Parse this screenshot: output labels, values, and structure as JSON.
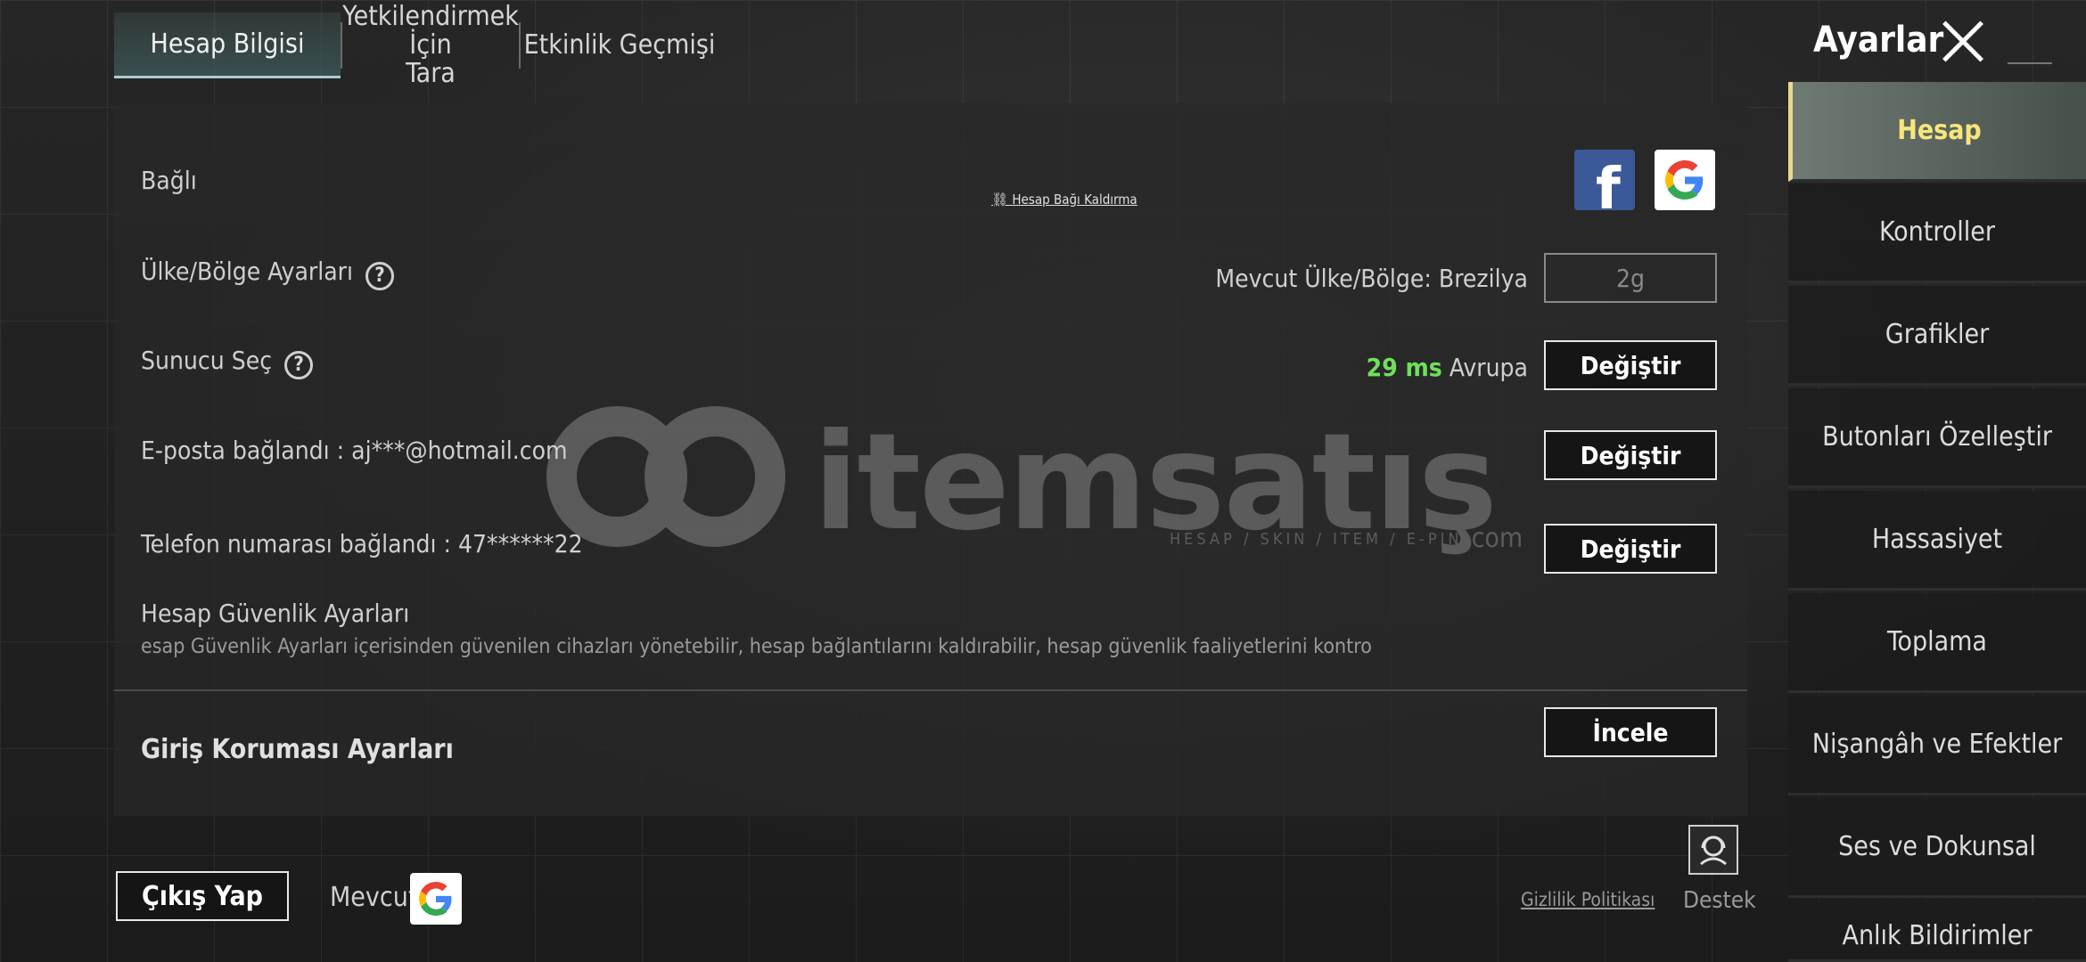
{
  "tabs": [
    {
      "label": "Hesap Bilgisi"
    },
    {
      "label_line1": "Yetkilendirmek İçin",
      "label_line2": "Tara"
    },
    {
      "label": "Etkinlik Geçmişi"
    }
  ],
  "header": {
    "title": "Ayarlar",
    "close_icon": "close-icon"
  },
  "account": {
    "linked_label": "Bağlı",
    "unlink_label": "Hesap Bağı Kaldırma",
    "region_label": "Ülke/Bölge Ayarları",
    "region_current": "Mevcut Ülke/Bölge: Brezilya",
    "region_button": "2g",
    "server_label": "Sunucu Seç",
    "server_ping": "29 ms",
    "server_region": "Avrupa",
    "change_button": "Değiştir",
    "email_label": "E-posta bağlandı : aj***@hotmail.com",
    "phone_label": "Telefon numarası bağlandı : 47******22",
    "security_label": "Hesap Güvenlik Ayarları",
    "security_desc": "esap Güvenlik Ayarları içerisinden güvenilen cihazları yönetebilir, hesap bağlantılarını kaldırabilir, hesap güvenlik faaliyetlerini kontro",
    "review_button": "İncele",
    "login_protection_label": "Giriş Koruması Ayarları"
  },
  "nav": {
    "items": [
      {
        "label": "Hesap",
        "active": true
      },
      {
        "label": "Kontroller"
      },
      {
        "label": "Grafikler"
      },
      {
        "label": "Butonları Özelleştir"
      },
      {
        "label": "Hassasiyet"
      },
      {
        "label": "Toplama"
      },
      {
        "label": "Nişangâh ve Efektler"
      },
      {
        "label": "Ses ve Dokunsal"
      },
      {
        "label": "Anlık Bildirimler"
      }
    ]
  },
  "footer": {
    "logout": "Çıkış Yap",
    "current": "Mevcut",
    "privacy": "Gizlilik Politikası",
    "support": "Destek"
  },
  "watermark": {
    "brand": "itemsatış",
    "tagline": "HESAP / SKIN / ITEM / E-PIN",
    "suffix": ".com"
  },
  "colors": {
    "ping_green": "#6fe05c",
    "active_nav_text": "#f7e67a",
    "facebook_blue": "#3b5998"
  }
}
